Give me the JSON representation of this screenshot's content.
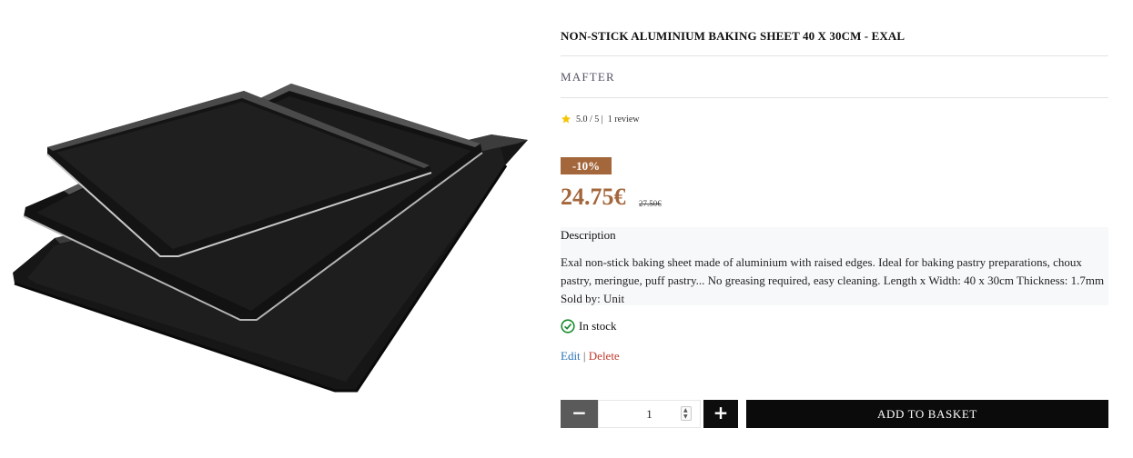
{
  "product": {
    "title": "NON-STICK ALUMINIUM BAKING SHEET 40 X 30CM - EXAL",
    "brand": "MAFTER",
    "rating": {
      "score_text": "5.0 / 5 |",
      "review_text": "1 review",
      "stars": 1,
      "star_color": "#f5c400"
    },
    "discount_badge": "-10%",
    "price": "24.75€",
    "old_price": "27.50€",
    "accent_color": "#a4663b",
    "description": {
      "title": "Description",
      "text": "Exal non-stick baking sheet made of aluminium with raised edges. Ideal for baking pastry preparations, choux pastry, meringue, puff pastry... No greasing required, easy cleaning. Length x Width: 40 x 30cm Thickness: 1.7mm Sold by: Unit"
    },
    "stock": {
      "label": "In stock",
      "icon": "check-circle-icon",
      "color": "#1a8a2e"
    },
    "actions": {
      "edit": "Edit",
      "separator": "|",
      "delete": "Delete"
    },
    "cart": {
      "minus": "−",
      "quantity": "1",
      "plus": "+",
      "add_label": "ADD TO BASKET"
    },
    "image": {
      "icon": "baking-trays-image"
    }
  }
}
